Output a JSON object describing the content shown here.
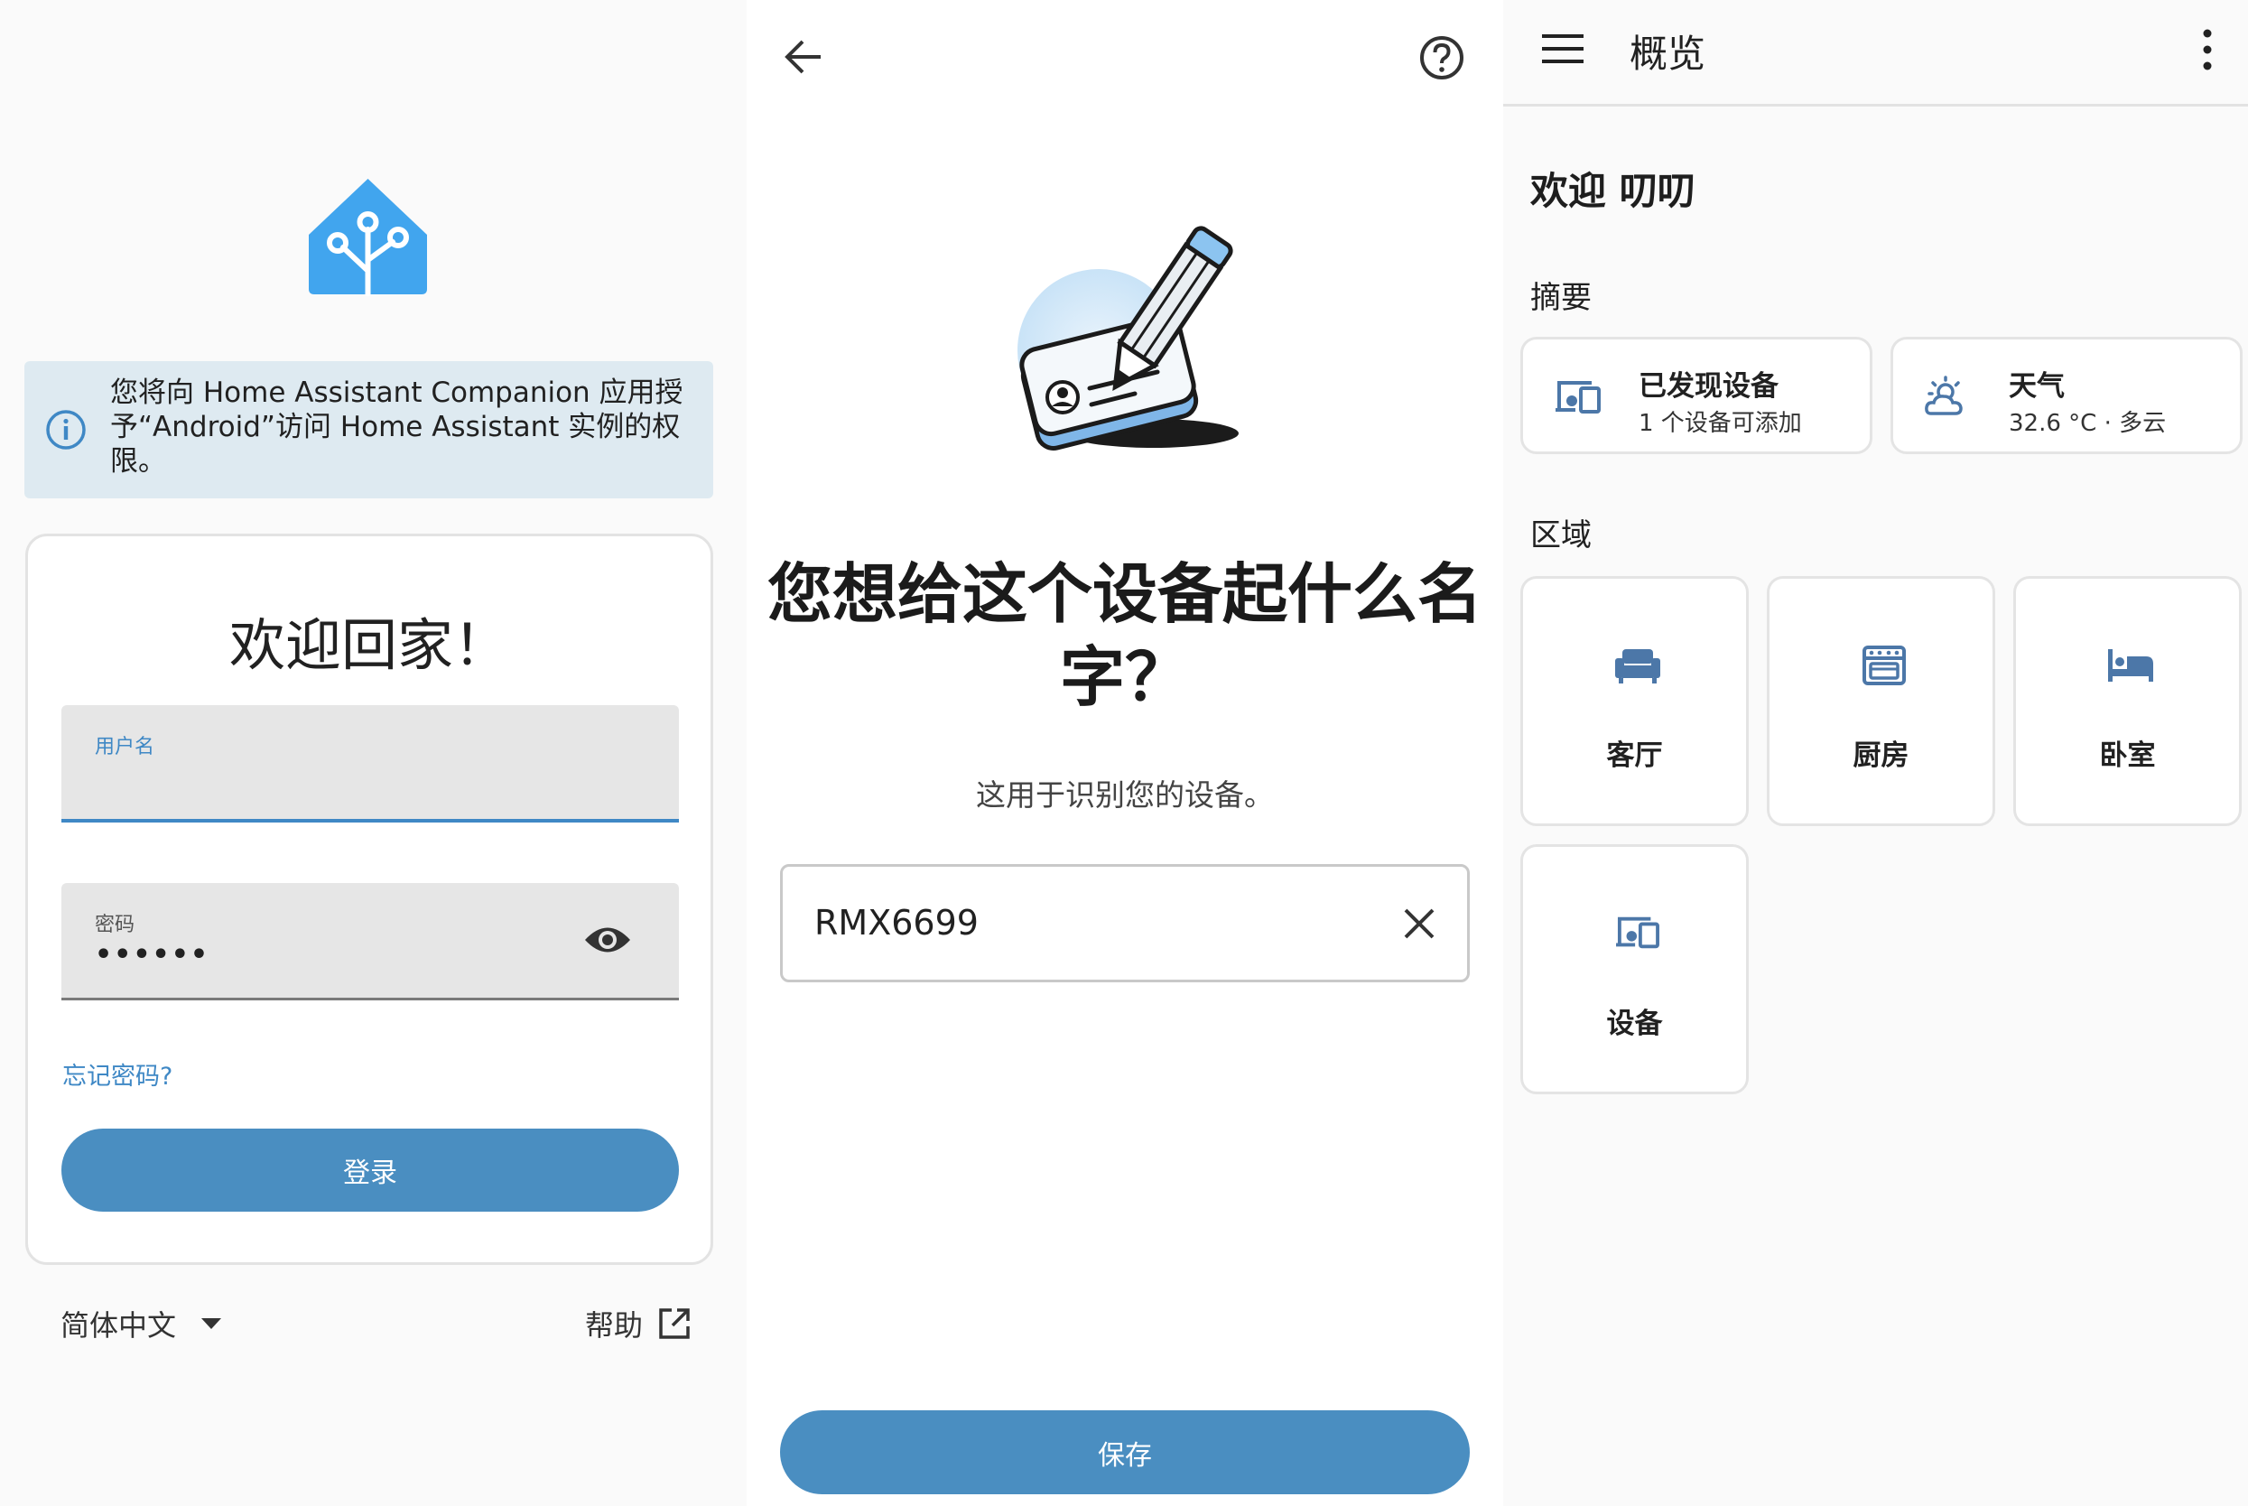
{
  "colors": {
    "primary": "#4a8ec1",
    "logo_blue": "#41a5ee",
    "info_bg": "#deeaf1",
    "icon_blue": "#4c77a8"
  },
  "login": {
    "info_text": "您将向 Home Assistant Companion 应用授予“Android”访问 Home Assistant 实例的权限。",
    "welcome_title": "欢迎回家！",
    "username_label": "用户名",
    "username_value": "",
    "password_label": "密码",
    "password_value": "••••••",
    "forgot_password": "忘记密码?",
    "login_button": "登录",
    "language": "简体中文",
    "help": "帮助"
  },
  "device_name": {
    "title": "您想给这个设备起什么名字？",
    "subtitle": "这用于识别您的设备。",
    "input_value": "RMX6699",
    "save_button": "保存"
  },
  "overview": {
    "title": "概览",
    "welcome": "欢迎 叨叨",
    "summary_label": "摘要",
    "summary_cards": [
      {
        "title": "已发现设备",
        "subtitle": "1 个设备可添加",
        "icon": "devices-icon"
      },
      {
        "title": "天气",
        "subtitle": "32.6 °C · 多云",
        "icon": "weather-partly-cloudy-icon"
      }
    ],
    "areas_label": "区域",
    "areas": [
      {
        "label": "客厅",
        "icon": "sofa-icon"
      },
      {
        "label": "厨房",
        "icon": "stove-icon"
      },
      {
        "label": "卧室",
        "icon": "bed-icon"
      },
      {
        "label": "设备",
        "icon": "devices-icon"
      }
    ]
  }
}
